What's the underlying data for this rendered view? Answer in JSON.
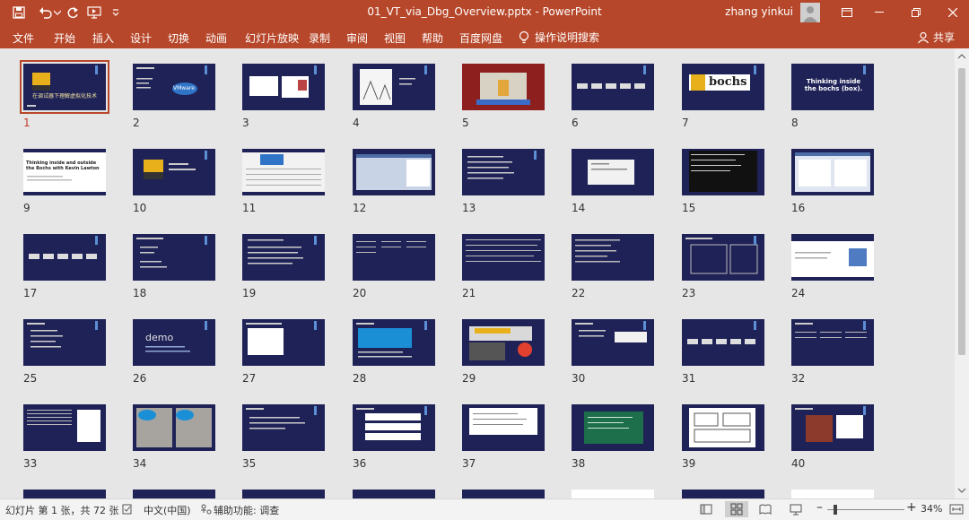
{
  "app": {
    "document_title": "01_VT_via_Dbg_Overview.pptx  -  PowerPoint",
    "user_name": "zhang yinkui"
  },
  "ribbon": {
    "tabs": [
      "文件",
      "开始",
      "插入",
      "设计",
      "切换",
      "动画",
      "幻灯片放映",
      "录制",
      "审阅",
      "视图",
      "帮助",
      "百度网盘"
    ],
    "tell_me": "操作说明搜索",
    "share": "共享"
  },
  "slides": {
    "numbers": [
      "1",
      "2",
      "3",
      "4",
      "5",
      "6",
      "7",
      "8",
      "9",
      "10",
      "11",
      "12",
      "13",
      "14",
      "15",
      "16",
      "17",
      "18",
      "19",
      "20",
      "21",
      "22",
      "23",
      "24",
      "25",
      "26",
      "27",
      "28",
      "29",
      "30",
      "31",
      "32",
      "33",
      "34",
      "35",
      "36",
      "37",
      "38",
      "39",
      "40"
    ],
    "selected": "1",
    "titles": {
      "s1": "在调试器下理解虚拟化技术",
      "s2": "VMware",
      "s7": "bochs",
      "s8": "Thinking inside the bochs (box).",
      "s9": "Thinking inside and outside the Bochs with Kevin Lawton",
      "s26": "demo"
    }
  },
  "status": {
    "slide_info": "幻灯片 第 1 张，共 72 张",
    "language": "中文(中国)",
    "accessibility": "辅助功能: 调查",
    "zoom": "34%"
  },
  "colors": {
    "accent": "#b7472a",
    "slide_bg": "#1f2257"
  }
}
